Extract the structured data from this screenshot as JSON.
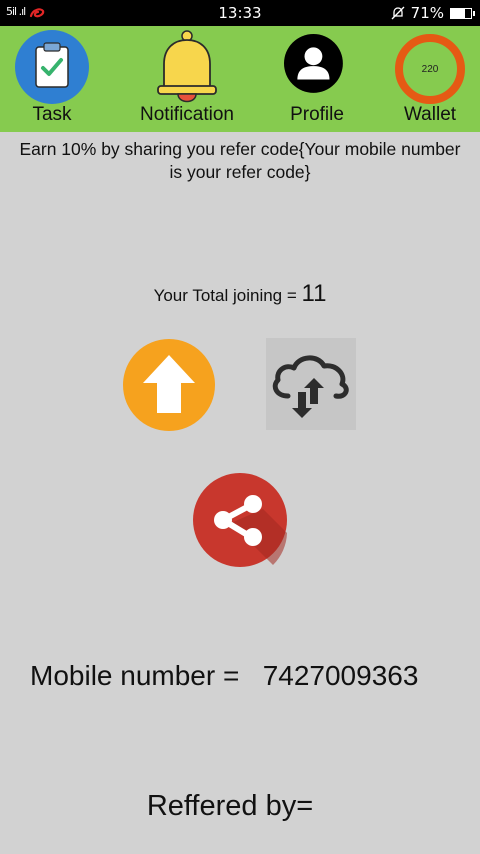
{
  "status_bar": {
    "signal_text": "5il .ıl",
    "time": "13:33",
    "battery_percent": "71%",
    "battery_level": 0.71
  },
  "nav": {
    "items": [
      {
        "label": "Task",
        "icon": "clipboard-check-icon"
      },
      {
        "label": "Notification",
        "icon": "bell-icon"
      },
      {
        "label": "Profile",
        "icon": "person-icon"
      },
      {
        "label": "Wallet",
        "icon": "wallet-ring-icon",
        "value": "220"
      }
    ]
  },
  "info": {
    "line1": "Earn 10% by sharing you refer code{Your mobile number",
    "line2": "is your refer code}"
  },
  "joining": {
    "label": "Your Total joining = ",
    "count": "11"
  },
  "mobile": {
    "label": "Mobile number =",
    "value": "7427009363"
  },
  "referred": {
    "label": "Reffered by="
  },
  "colors": {
    "nav_bg": "#86cb4f",
    "page_bg": "#d2d2d2",
    "task_blue": "#2f7fd2",
    "bell_yellow": "#f7d64c",
    "wallet_orange": "#e55a14",
    "upload_orange": "#f6a21e",
    "share_red": "#c8372d"
  }
}
